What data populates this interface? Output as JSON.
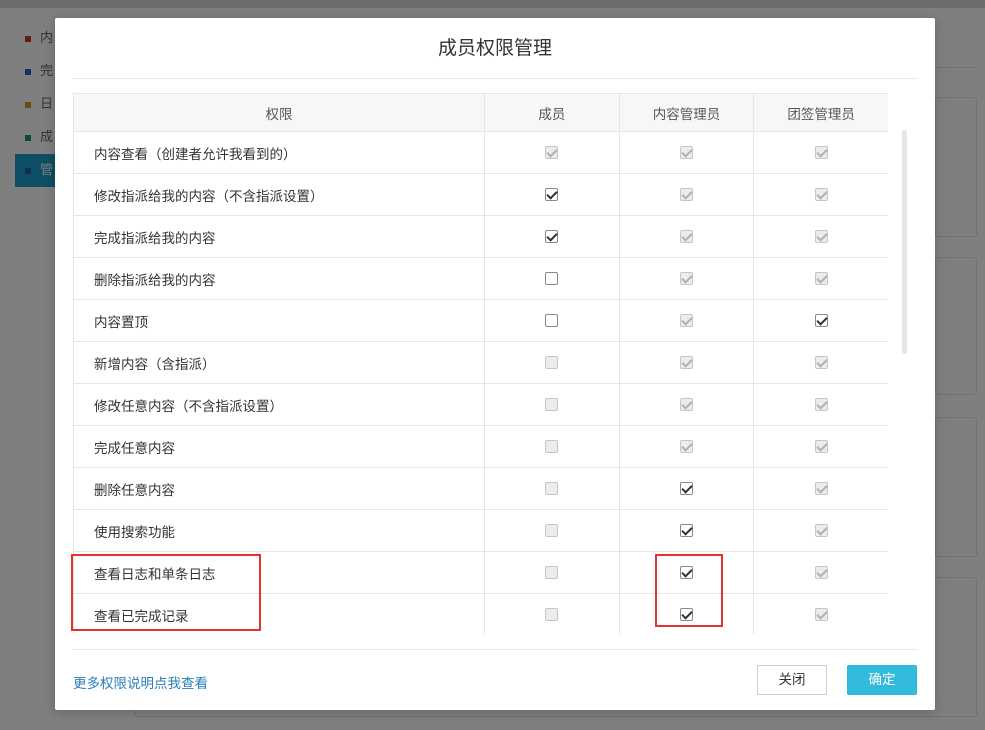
{
  "background": {
    "nav": [
      {
        "label": "内",
        "color": "#c0392b",
        "active": false
      },
      {
        "label": "完",
        "color": "#2c5fd0",
        "active": false
      },
      {
        "label": "日",
        "color": "#d79b1a",
        "active": false
      },
      {
        "label": "成",
        "color": "#1a9b5a",
        "active": false
      },
      {
        "label": "管",
        "color": "#1b5fb0",
        "active": true
      }
    ],
    "accent": "#1b9ec9"
  },
  "modal": {
    "title": "成员权限管理",
    "table": {
      "headers": [
        "权限",
        "成员",
        "内容管理员",
        "团签管理员"
      ],
      "rows": [
        {
          "label": "内容查看（创建者允许我看到的）",
          "member": {
            "checked": true,
            "disabled": true
          },
          "content_admin": {
            "checked": true,
            "disabled": true
          },
          "team_admin": {
            "checked": true,
            "disabled": true
          }
        },
        {
          "label": "修改指派给我的内容（不含指派设置）",
          "member": {
            "checked": true,
            "disabled": false
          },
          "content_admin": {
            "checked": true,
            "disabled": true
          },
          "team_admin": {
            "checked": true,
            "disabled": true
          }
        },
        {
          "label": "完成指派给我的内容",
          "member": {
            "checked": true,
            "disabled": false
          },
          "content_admin": {
            "checked": true,
            "disabled": true
          },
          "team_admin": {
            "checked": true,
            "disabled": true
          }
        },
        {
          "label": "删除指派给我的内容",
          "member": {
            "checked": false,
            "disabled": false
          },
          "content_admin": {
            "checked": true,
            "disabled": true
          },
          "team_admin": {
            "checked": true,
            "disabled": true
          }
        },
        {
          "label": "内容置顶",
          "member": {
            "checked": false,
            "disabled": false
          },
          "content_admin": {
            "checked": true,
            "disabled": true
          },
          "team_admin": {
            "checked": true,
            "disabled": false
          }
        },
        {
          "label": "新增内容（含指派）",
          "member": {
            "checked": false,
            "disabled": true
          },
          "content_admin": {
            "checked": true,
            "disabled": true
          },
          "team_admin": {
            "checked": true,
            "disabled": true
          }
        },
        {
          "label": "修改任意内容（不含指派设置）",
          "member": {
            "checked": false,
            "disabled": true
          },
          "content_admin": {
            "checked": true,
            "disabled": true
          },
          "team_admin": {
            "checked": true,
            "disabled": true
          }
        },
        {
          "label": "完成任意内容",
          "member": {
            "checked": false,
            "disabled": true
          },
          "content_admin": {
            "checked": true,
            "disabled": true
          },
          "team_admin": {
            "checked": true,
            "disabled": true
          }
        },
        {
          "label": "删除任意内容",
          "member": {
            "checked": false,
            "disabled": true
          },
          "content_admin": {
            "checked": true,
            "disabled": false
          },
          "team_admin": {
            "checked": true,
            "disabled": true
          }
        },
        {
          "label": "使用搜索功能",
          "member": {
            "checked": false,
            "disabled": true
          },
          "content_admin": {
            "checked": true,
            "disabled": false
          },
          "team_admin": {
            "checked": true,
            "disabled": true
          }
        },
        {
          "label": "查看日志和单条日志",
          "member": {
            "checked": false,
            "disabled": true
          },
          "content_admin": {
            "checked": true,
            "disabled": false
          },
          "team_admin": {
            "checked": true,
            "disabled": true
          }
        },
        {
          "label": "查看已完成记录",
          "member": {
            "checked": false,
            "disabled": true
          },
          "content_admin": {
            "checked": true,
            "disabled": false
          },
          "team_admin": {
            "checked": true,
            "disabled": true
          }
        }
      ]
    },
    "footer": {
      "more_link": "更多权限说明点我查看",
      "close_label": "关闭",
      "ok_label": "确定"
    },
    "colors": {
      "primary_button": "#33bbdd",
      "link": "#2a7fb8",
      "highlight": "#e5322d"
    }
  }
}
